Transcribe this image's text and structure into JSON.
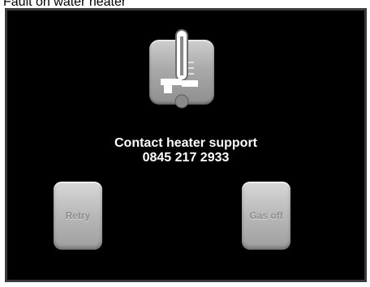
{
  "caption": "Fault on water heater",
  "icon": "thermometer-tap-icon",
  "message": {
    "line1": "Contact heater support",
    "line2": "0845 217 2933"
  },
  "buttons": {
    "retry_label": "Retry",
    "gas_off_label": "Gas off"
  },
  "colors": {
    "screen_background": "#000000",
    "message_text": "#ffffff",
    "button_gray": "#b8b8b8"
  }
}
